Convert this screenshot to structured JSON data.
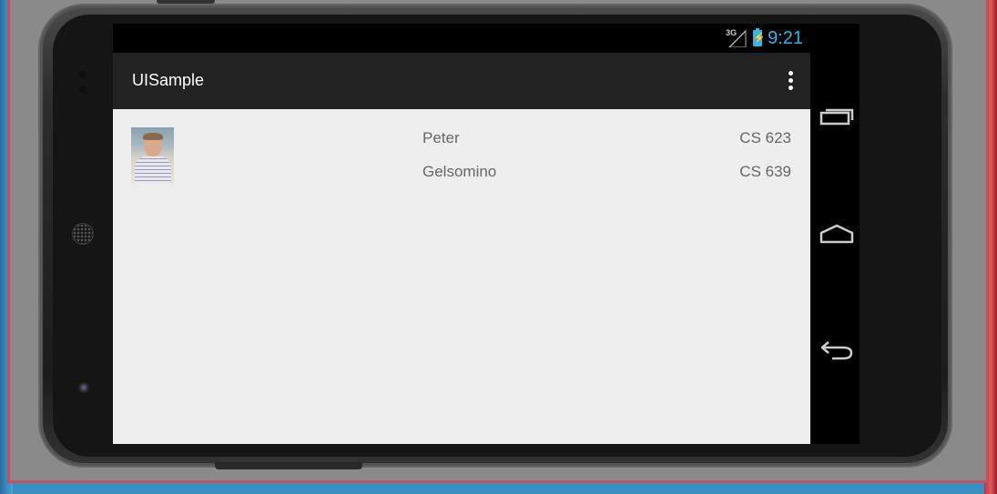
{
  "status_bar": {
    "network_label": "3G",
    "time": "9:21",
    "signal_icon": "signal-3g-icon",
    "battery_icon": "battery-charging-icon"
  },
  "action_bar": {
    "title": "UISample",
    "overflow_icon": "overflow-menu-icon"
  },
  "list": {
    "avatar_icon": "person-photo",
    "rows": [
      {
        "name": "Peter",
        "course": "CS 623"
      },
      {
        "name": "Gelsomino",
        "course": "CS 639"
      }
    ]
  },
  "nav_bar": {
    "recents_icon": "recent-apps-icon",
    "home_icon": "home-icon",
    "back_icon": "back-icon"
  },
  "colors": {
    "accent": "#33b5e5",
    "action_bar": "#222222",
    "content_bg": "#eeeeee",
    "text": "#666666"
  }
}
